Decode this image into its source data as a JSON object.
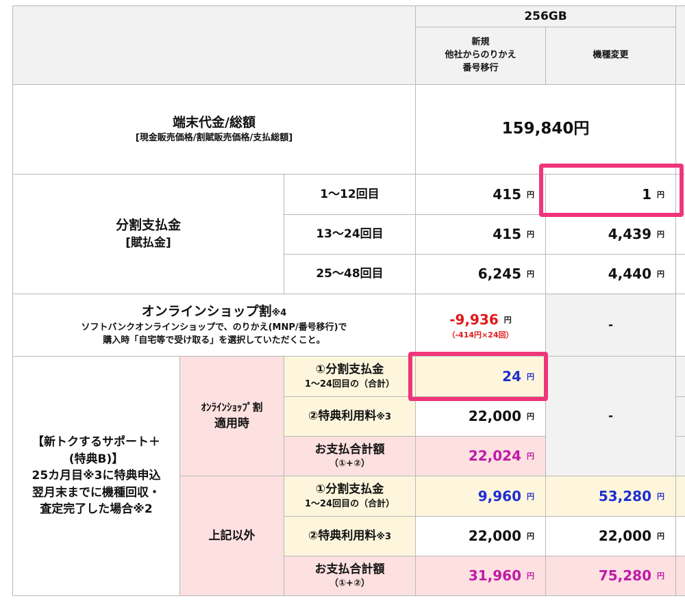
{
  "header": {
    "capacity": "256GB",
    "col_new": [
      "新規",
      "他社からのりかえ",
      "番号移行"
    ],
    "col_change": "機種変更"
  },
  "device_price": {
    "label": "端末代金/総額",
    "sublabel": "[現金販売価格/割賦販売価格/支払総額]",
    "value": "159,840円"
  },
  "installment": {
    "label": "分割支払金",
    "sublabel": "[賦払金]",
    "unit": "円",
    "rows": [
      {
        "period": "1〜12回目",
        "new": "415",
        "change": "1"
      },
      {
        "period": "13〜24回目",
        "new": "415",
        "change": "4,439"
      },
      {
        "period": "25〜48回目",
        "new": "6,245",
        "change": "4,440"
      }
    ]
  },
  "online_discount": {
    "title": "オンラインショップ割",
    "note_ref": "※4",
    "desc1": "ソフトバンクオンラインショップで、のりかえ(MNP/番号移行)で",
    "desc2": "購入時「自宅等で受け取る」を選択していただくこと。",
    "new_value": "-9,936",
    "new_sub": "（-414円×24回）",
    "change_value": "-"
  },
  "support": {
    "label_lines": [
      "【新トクするサポート＋",
      "(特典B)】",
      "25カ月目※3に特典申込",
      "翌月末までに機種回収・",
      "査定完了した場合※2"
    ],
    "with_discount": {
      "label_lines": [
        "ｵﾝﾗｲﾝｼｮｯﾌﾟ割",
        "適用時"
      ],
      "change_value": "-",
      "rows": [
        {
          "title": "①分割支払金",
          "sub": "1〜24回目の（合計）",
          "new": "24"
        },
        {
          "title": "②特典利用料",
          "title_suffix": "※3",
          "new": "22,000"
        },
        {
          "title": "お支払合計額",
          "sub": "（①+②）",
          "new": "22,024"
        }
      ]
    },
    "other": {
      "label": "上記以外",
      "rows": [
        {
          "title": "①分割支払金",
          "sub": "1〜24回目の（合計）",
          "new": "9,960",
          "change": "53,280"
        },
        {
          "title": "②特典利用料",
          "title_suffix": "※3",
          "new": "22,000",
          "change": "22,000"
        },
        {
          "title": "お支払合計額",
          "sub": "（①+②）",
          "new": "31,960",
          "change": "75,280"
        }
      ]
    }
  },
  "colors": {
    "highlight": "#f0357a",
    "blue_value": "#1f2fd0",
    "purple_value": "#c01aa8",
    "red_value": "#e01818",
    "pink_bg": "#fde0e0",
    "cream_bg": "#fdf6dc",
    "gray_bg": "#f2f2f2"
  }
}
